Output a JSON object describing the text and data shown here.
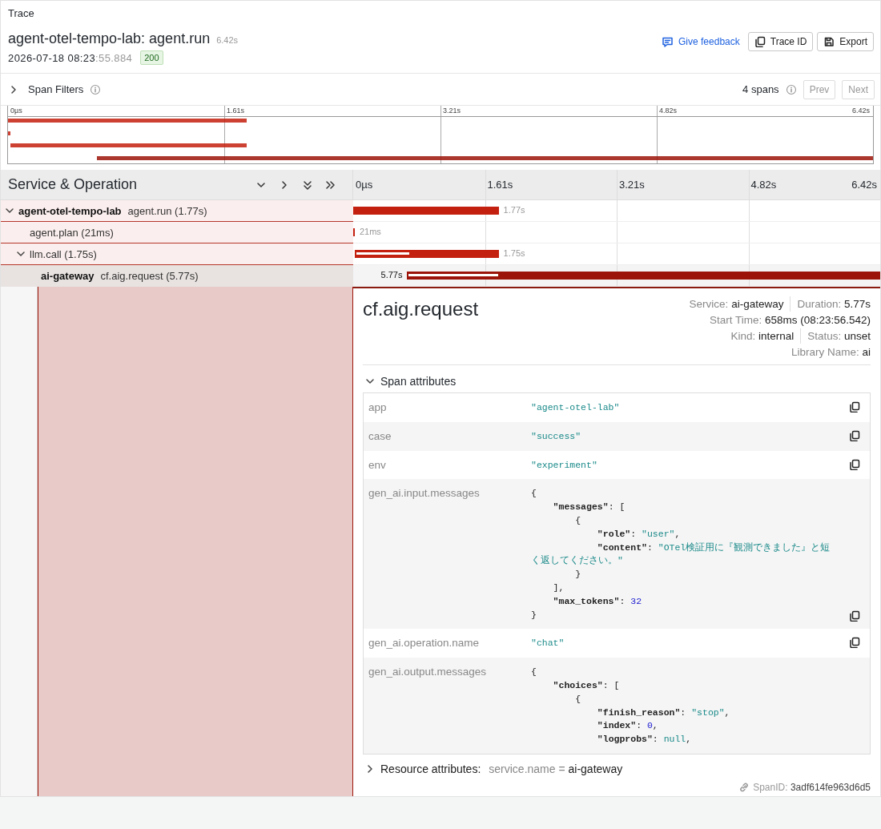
{
  "header": {
    "section_title": "Trace",
    "trace_name": "agent-otel-tempo-lab: agent.run",
    "duration": "6.42s",
    "date": "2026-07-18 08:23",
    "date_seconds": ":55.884",
    "status_code": "200",
    "actions": [
      {
        "kind": "link",
        "label": "Give feedback"
      },
      {
        "kind": "copy",
        "label": "Trace ID"
      },
      {
        "kind": "save",
        "label": "Export"
      }
    ]
  },
  "span_filters": {
    "label": "Span Filters",
    "expanded": false,
    "count": "4 spans",
    "buttons": [
      {
        "label": "Prev",
        "disabled": true
      },
      {
        "label": "Next",
        "disabled": true
      }
    ]
  },
  "minimap": {
    "ticks": [
      "0µs",
      "1.61s",
      "3.21s",
      "4.82s",
      "6.42s"
    ]
  },
  "timeline": {
    "column_title": "Service & Operation",
    "ticks": [
      "0µs",
      "1.61s",
      "3.21s",
      "4.82s",
      "6.42s"
    ],
    "spans": [
      {
        "service": "agent-otel-tempo-lab",
        "operation": "agent.run (1.77s)",
        "expanded": true,
        "selected": false,
        "color": "#c4200f",
        "bar": {
          "level": 0.276
        },
        "label": "1.77s",
        "children": [
          {
            "operation": "agent.plan (21ms)",
            "selected": false,
            "color": "#c4200f",
            "bar": {
              "level": 0.003
            },
            "label": "21ms"
          },
          {
            "operation": "llm.call (1.75s)",
            "expanded": true,
            "selected": false,
            "color": "#c4200f",
            "offset": {
              "level": 0.003
            },
            "bar": {
              "level": 0.273
            },
            "inner": {
              "level": 0.1
            },
            "label": "1.75s",
            "children": [
              {
                "service": "ai-gateway",
                "operation": "cf.aig.request (5.77s)",
                "selected": true,
                "color": "#9c1409",
                "offset": {
                  "level": 0.1025
                },
                "bar": {
                  "level": 0.8975
                },
                "inner": {
                  "level": 0.17
                },
                "label": "5.77s"
              }
            ]
          }
        ]
      }
    ]
  },
  "detail": {
    "title": "cf.aig.request",
    "meta": [
      [
        {
          "label": "Service:",
          "value": "ai-gateway"
        },
        {
          "label": "Duration:",
          "value": "5.77s"
        }
      ],
      [
        {
          "label": "Start Time:",
          "value": "658ms (08:23:56.542)"
        }
      ],
      [
        {
          "label": "Kind:",
          "value": "internal"
        },
        {
          "label": "Status:",
          "value": "unset"
        }
      ],
      [
        {
          "label": "Library Name:",
          "value": "ai"
        }
      ]
    ],
    "span_attributes": {
      "label": "Span attributes",
      "expanded": true,
      "rows": [
        {
          "key": "app",
          "copy": true,
          "lines": [
            [
              {
                "kind": "string",
                "text": "\"agent-otel-lab\""
              }
            ]
          ]
        },
        {
          "key": "case",
          "copy": true,
          "lines": [
            [
              {
                "kind": "string",
                "text": "\"success\""
              }
            ]
          ]
        },
        {
          "key": "env",
          "copy": true,
          "lines": [
            [
              {
                "kind": "string",
                "text": "\"experiment\""
              }
            ]
          ]
        },
        {
          "key": "gen_ai.input.messages",
          "copy": true,
          "lines": [
            [
              {
                "kind": "punct",
                "text": "{"
              }
            ],
            [
              {
                "kind": "key",
                "text": "    \"messages\""
              },
              {
                "kind": "punct",
                "text": ": ["
              }
            ],
            [
              {
                "kind": "punct",
                "text": "        {"
              }
            ],
            [
              {
                "kind": "key",
                "text": "            \"role\""
              },
              {
                "kind": "punct",
                "text": ": "
              },
              {
                "kind": "string",
                "text": "\"user\""
              },
              {
                "kind": "punct",
                "text": ","
              }
            ],
            [
              {
                "kind": "key",
                "text": "            \"content\""
              },
              {
                "kind": "punct",
                "text": ": "
              },
              {
                "kind": "string",
                "text": "\"OTel検証用に『観測できました』と短く返してください。\""
              }
            ],
            [
              {
                "kind": "punct",
                "text": "        }"
              }
            ],
            [
              {
                "kind": "punct",
                "text": "    ],"
              }
            ],
            [
              {
                "kind": "key",
                "text": "    \"max_tokens\""
              },
              {
                "kind": "punct",
                "text": ": "
              },
              {
                "kind": "number",
                "text": "32"
              }
            ],
            [
              {
                "kind": "punct",
                "text": "}"
              }
            ]
          ]
        },
        {
          "key": "gen_ai.operation.name",
          "copy": true,
          "lines": [
            [
              {
                "kind": "string",
                "text": "\"chat\""
              }
            ]
          ]
        },
        {
          "key": "gen_ai.output.messages",
          "copy": false,
          "lines": [
            [
              {
                "kind": "punct",
                "text": "{"
              }
            ],
            [
              {
                "kind": "key",
                "text": "    \"choices\""
              },
              {
                "kind": "punct",
                "text": ": ["
              }
            ],
            [
              {
                "kind": "punct",
                "text": "        {"
              }
            ],
            [
              {
                "kind": "key",
                "text": "            \"finish_reason\""
              },
              {
                "kind": "punct",
                "text": ": "
              },
              {
                "kind": "string",
                "text": "\"stop\""
              },
              {
                "kind": "punct",
                "text": ","
              }
            ],
            [
              {
                "kind": "key",
                "text": "            \"index\""
              },
              {
                "kind": "punct",
                "text": ": "
              },
              {
                "kind": "number",
                "text": "0"
              },
              {
                "kind": "punct",
                "text": ","
              }
            ],
            [
              {
                "kind": "key",
                "text": "            \"logprobs\""
              },
              {
                "kind": "punct",
                "text": ": "
              },
              {
                "kind": "null",
                "text": "null"
              },
              {
                "kind": "punct",
                "text": ","
              }
            ]
          ]
        }
      ]
    },
    "resource_attributes": {
      "label": "Resource attributes:",
      "expanded": false,
      "key": "service.name",
      "operator": "=",
      "value": "ai-gateway"
    },
    "span_id": {
      "label": "SpanID:",
      "value": "3adf614fe963d6d5"
    }
  }
}
